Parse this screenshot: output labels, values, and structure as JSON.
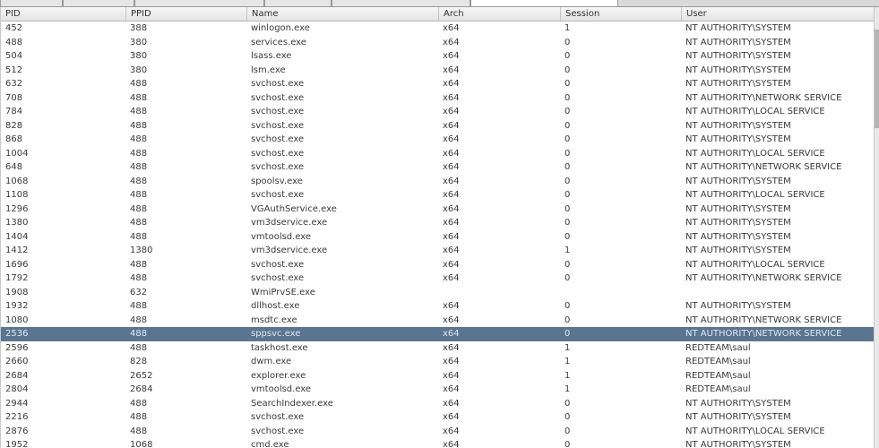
{
  "columns": [
    {
      "key": "pid",
      "label": "PID"
    },
    {
      "key": "ppid",
      "label": "PPID"
    },
    {
      "key": "name",
      "label": "Name"
    },
    {
      "key": "arch",
      "label": "Arch"
    },
    {
      "key": "session",
      "label": "Session"
    },
    {
      "key": "user",
      "label": "User"
    }
  ],
  "selected_row_index": 22,
  "selection_color": "#5a7590",
  "rows": [
    {
      "pid": "452",
      "ppid": "388",
      "name": "winlogon.exe",
      "arch": "x64",
      "session": "1",
      "user": "NT AUTHORITY\\SYSTEM"
    },
    {
      "pid": "488",
      "ppid": "380",
      "name": "services.exe",
      "arch": "x64",
      "session": "0",
      "user": "NT AUTHORITY\\SYSTEM"
    },
    {
      "pid": "504",
      "ppid": "380",
      "name": "lsass.exe",
      "arch": "x64",
      "session": "0",
      "user": "NT AUTHORITY\\SYSTEM"
    },
    {
      "pid": "512",
      "ppid": "380",
      "name": "lsm.exe",
      "arch": "x64",
      "session": "0",
      "user": "NT AUTHORITY\\SYSTEM"
    },
    {
      "pid": "632",
      "ppid": "488",
      "name": "svchost.exe",
      "arch": "x64",
      "session": "0",
      "user": "NT AUTHORITY\\SYSTEM"
    },
    {
      "pid": "708",
      "ppid": "488",
      "name": "svchost.exe",
      "arch": "x64",
      "session": "0",
      "user": "NT AUTHORITY\\NETWORK SERVICE"
    },
    {
      "pid": "784",
      "ppid": "488",
      "name": "svchost.exe",
      "arch": "x64",
      "session": "0",
      "user": "NT AUTHORITY\\LOCAL SERVICE"
    },
    {
      "pid": "828",
      "ppid": "488",
      "name": "svchost.exe",
      "arch": "x64",
      "session": "0",
      "user": "NT AUTHORITY\\SYSTEM"
    },
    {
      "pid": "868",
      "ppid": "488",
      "name": "svchost.exe",
      "arch": "x64",
      "session": "0",
      "user": "NT AUTHORITY\\SYSTEM"
    },
    {
      "pid": "1004",
      "ppid": "488",
      "name": "svchost.exe",
      "arch": "x64",
      "session": "0",
      "user": "NT AUTHORITY\\LOCAL SERVICE"
    },
    {
      "pid": "648",
      "ppid": "488",
      "name": "svchost.exe",
      "arch": "x64",
      "session": "0",
      "user": "NT AUTHORITY\\NETWORK SERVICE"
    },
    {
      "pid": "1068",
      "ppid": "488",
      "name": "spoolsv.exe",
      "arch": "x64",
      "session": "0",
      "user": "NT AUTHORITY\\SYSTEM"
    },
    {
      "pid": "1108",
      "ppid": "488",
      "name": "svchost.exe",
      "arch": "x64",
      "session": "0",
      "user": "NT AUTHORITY\\LOCAL SERVICE"
    },
    {
      "pid": "1296",
      "ppid": "488",
      "name": "VGAuthService.exe",
      "arch": "x64",
      "session": "0",
      "user": "NT AUTHORITY\\SYSTEM"
    },
    {
      "pid": "1380",
      "ppid": "488",
      "name": "vm3dservice.exe",
      "arch": "x64",
      "session": "0",
      "user": "NT AUTHORITY\\SYSTEM"
    },
    {
      "pid": "1404",
      "ppid": "488",
      "name": "vmtoolsd.exe",
      "arch": "x64",
      "session": "0",
      "user": "NT AUTHORITY\\SYSTEM"
    },
    {
      "pid": "1412",
      "ppid": "1380",
      "name": "vm3dservice.exe",
      "arch": "x64",
      "session": "1",
      "user": "NT AUTHORITY\\SYSTEM"
    },
    {
      "pid": "1696",
      "ppid": "488",
      "name": "svchost.exe",
      "arch": "x64",
      "session": "0",
      "user": "NT AUTHORITY\\LOCAL SERVICE"
    },
    {
      "pid": "1792",
      "ppid": "488",
      "name": "svchost.exe",
      "arch": "x64",
      "session": "0",
      "user": "NT AUTHORITY\\NETWORK SERVICE"
    },
    {
      "pid": "1908",
      "ppid": "632",
      "name": "WmiPrvSE.exe",
      "arch": "",
      "session": "",
      "user": ""
    },
    {
      "pid": "1932",
      "ppid": "488",
      "name": "dllhost.exe",
      "arch": "x64",
      "session": "0",
      "user": "NT AUTHORITY\\SYSTEM"
    },
    {
      "pid": "1080",
      "ppid": "488",
      "name": "msdtc.exe",
      "arch": "x64",
      "session": "0",
      "user": "NT AUTHORITY\\NETWORK SERVICE"
    },
    {
      "pid": "2536",
      "ppid": "488",
      "name": "sppsvc.exe",
      "arch": "x64",
      "session": "0",
      "user": "NT AUTHORITY\\NETWORK SERVICE"
    },
    {
      "pid": "2596",
      "ppid": "488",
      "name": "taskhost.exe",
      "arch": "x64",
      "session": "1",
      "user": "REDTEAM\\saul"
    },
    {
      "pid": "2660",
      "ppid": "828",
      "name": "dwm.exe",
      "arch": "x64",
      "session": "1",
      "user": "REDTEAM\\saul"
    },
    {
      "pid": "2684",
      "ppid": "2652",
      "name": "explorer.exe",
      "arch": "x64",
      "session": "1",
      "user": "REDTEAM\\saul"
    },
    {
      "pid": "2804",
      "ppid": "2684",
      "name": "vmtoolsd.exe",
      "arch": "x64",
      "session": "1",
      "user": "REDTEAM\\saul"
    },
    {
      "pid": "2944",
      "ppid": "488",
      "name": "SearchIndexer.exe",
      "arch": "x64",
      "session": "0",
      "user": "NT AUTHORITY\\SYSTEM"
    },
    {
      "pid": "2216",
      "ppid": "488",
      "name": "svchost.exe",
      "arch": "x64",
      "session": "0",
      "user": "NT AUTHORITY\\SYSTEM"
    },
    {
      "pid": "2876",
      "ppid": "488",
      "name": "svchost.exe",
      "arch": "x64",
      "session": "0",
      "user": "NT AUTHORITY\\LOCAL SERVICE"
    },
    {
      "pid": "1952",
      "ppid": "1068",
      "name": "cmd.exe",
      "arch": "x64",
      "session": "0",
      "user": "NT AUTHORITY\\SYSTEM"
    }
  ]
}
